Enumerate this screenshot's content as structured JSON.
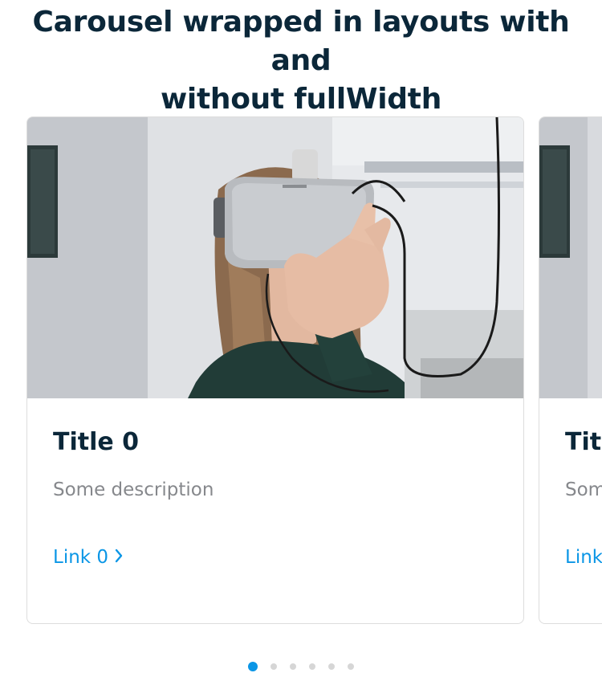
{
  "heading": {
    "line1": "Carousel wrapped in layouts with and",
    "line2": "without fullWidth"
  },
  "cards": [
    {
      "title": "Title 0",
      "description": "Some description",
      "link": "Link 0",
      "image": "person-wearing-vr-headset-photo"
    },
    {
      "title": "Tit",
      "description": "Som",
      "link": "Link",
      "image": "person-wearing-vr-headset-photo"
    }
  ],
  "pagination": {
    "pages": 6,
    "active_index": 0
  },
  "colors": {
    "heading": "#0b2739",
    "description": "#86888c",
    "link": "#0b96e6",
    "dot_active": "#0b96e6",
    "dot_inactive": "#d6d6d6",
    "card_border": "#dddddd"
  },
  "icons": {
    "link_icon": "chevron-right-icon"
  }
}
